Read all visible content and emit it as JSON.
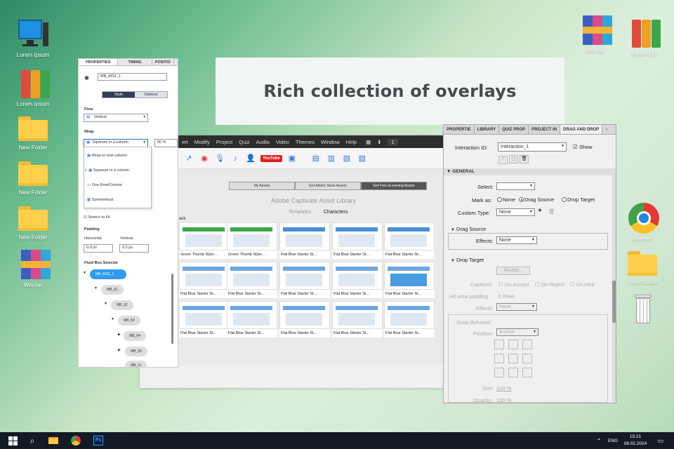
{
  "banner": {
    "title": "Rich collection of overlays"
  },
  "desktop_left": [
    {
      "label": "Lorem Ipsum",
      "icon": "computer-icon"
    },
    {
      "label": "Lorem Ipsum",
      "icon": "binders-icon"
    },
    {
      "label": "New Folder",
      "icon": "folder-icon"
    },
    {
      "label": "New Folder",
      "icon": "folder-icon"
    },
    {
      "label": "New Folder",
      "icon": "folder-icon"
    },
    {
      "label": "Win-rar",
      "icon": "winrar-icon"
    }
  ],
  "desktop_right": [
    {
      "label": "Win-rar",
      "icon": "winrar-icon"
    },
    {
      "label": "Folder (1)",
      "icon": "binders-icon"
    },
    {
      "label": "Internet",
      "icon": "chrome-icon"
    },
    {
      "label": "New Folder",
      "icon": "folder-icon"
    },
    {
      "label": "",
      "icon": "recycle-bin-icon"
    }
  ],
  "app": {
    "menu": [
      "ert",
      "Modify",
      "Project",
      "Quiz",
      "Audio",
      "Video",
      "Themes",
      "Window",
      "Help"
    ],
    "page_number": "1",
    "youtube": "YouTube",
    "library_tabs": [
      "My Assets",
      "Get Adobe Stock Assets",
      "Get Free eLearning Assets"
    ],
    "library_title": "Adobe Captivate Asset Library",
    "library_subtabs": [
      "Templates",
      "Characters"
    ],
    "back_label": "ack",
    "thumb_captions": [
      "Green Thumb Style...",
      "Green Thumb Style...",
      "Flat Blue Starter St...",
      "Flat Blue Starter St...",
      "Flat Blue Starter St...",
      "Flat Blue Starter St...",
      "Flat Blue Starter St...",
      "Flat Blue Starter St...",
      "Flat Blue Starter St...",
      "Flat Blue Starter St...",
      "Flat Blue Starter St...",
      "Flat Blue Starter St...",
      "Flat Blue Starter St...",
      "Flat Blue Starter St...",
      "Flat Blue Starter St..."
    ]
  },
  "properties": {
    "tabs": [
      "PROPERTIES",
      "TIMING",
      "POSITIO"
    ],
    "name": "MB_MS3_1",
    "style_tabs": [
      "Style",
      "Options"
    ],
    "flow_label": "Flow",
    "flow_value": "Vertical",
    "wrap_label": "Wrap",
    "wrap_value": "Squeeze in a column",
    "wrap_percent": "80 %",
    "wrap_options": [
      "Wrap to next column",
      "Squeeze in a column",
      "One Row/Column",
      "Symmetrical"
    ],
    "stretch_label": "Stretch to Fit",
    "padding_label": "Padding",
    "horizontal_label": "Horizontal",
    "vertical_label": "Vertical",
    "horizontal_value": "0.0  px",
    "vertical_value": "0.0  px",
    "fluid_box_label": "Fluid Box Selector",
    "tree": [
      "MB_MS3_1",
      "MB_61",
      "MB_62",
      "MB_63",
      "MB_64",
      "MB_65",
      "MB_%"
    ]
  },
  "dnd": {
    "tabs": [
      "PROPERTIE",
      "LIBRARY",
      "QUIZ PROP",
      "PROJECT IN",
      "DRAG AND DROP"
    ],
    "interaction_id_label": "Interaction ID:",
    "interaction_id": "Interaction_1",
    "show_label": "Show",
    "general_label": "GENERAL",
    "select_label": "Select:",
    "mark_as_label": "Mark as:",
    "mark_options": [
      "None",
      "Drag Source",
      "Drop Target"
    ],
    "mark_selected": "Drag Source",
    "custom_type_label": "Custom Type:",
    "custom_type_value": "None",
    "drag_source_label": "Drag Source",
    "effects_label": "Effects:",
    "effects_value": "None",
    "drop_target_label": "Drop Target",
    "accept_label": "Accept...",
    "captions_label": "Captions:",
    "caption_options": [
      "On Accept",
      "On Reject",
      "On Hint"
    ],
    "hit_padding_label": "Hit area padding:",
    "hit_padding_value": "0 Pixel",
    "drop_effects_label": "Effects:",
    "drop_effects_value": "None",
    "snap_label": "Snap Behavior",
    "position_label": "Position:",
    "position_value": "Anchor",
    "size_label": "Size:",
    "size_value": "100 %",
    "opacity_label": "Opacity:",
    "opacity_value": "100 %"
  },
  "taskbar": {
    "lang": "ENG",
    "time": "15:21",
    "date": "08.02.2024",
    "ps_label": "Ps"
  }
}
